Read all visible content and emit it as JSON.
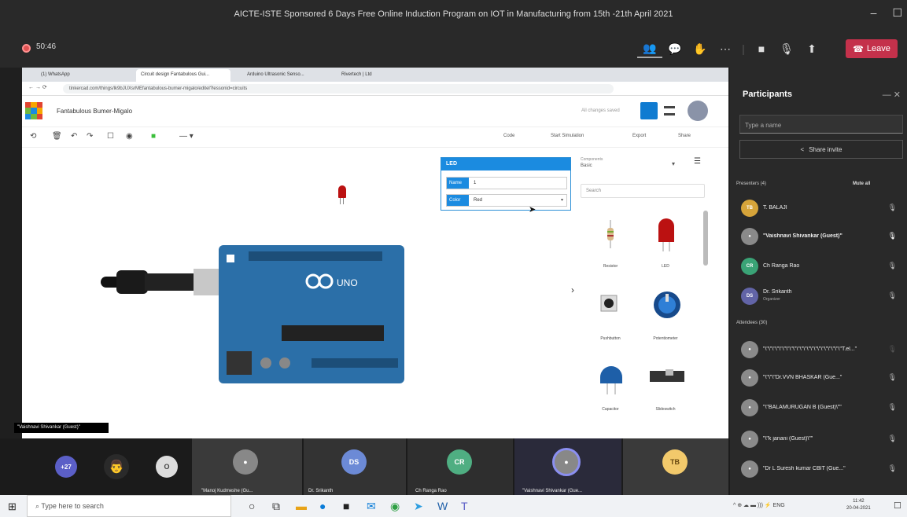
{
  "window": {
    "title": "AICTE-ISTE Sponsored 6 Days Free Online Induction Program on IOT in Manufacturing from 15th -21th April 2021",
    "minimize": "–",
    "maximize": "☐"
  },
  "meeting": {
    "timer": "50:46",
    "leave_label": "Leave"
  },
  "browser": {
    "tabs": [
      "(1) WhatsApp",
      "Circuit design Fantabulous Gui...",
      "Arduino Ultrasonic Senso...",
      "Rivertech | Ltd"
    ],
    "url": "tinkercad.com/things/lk9bJUXsrMEfantabulous-bumer-migalo/editel?lessonid=circuits"
  },
  "tinkercad": {
    "design_name": "Fantabulous Bumer-Migalo",
    "all_changes": "All changes saved",
    "code": "Code",
    "start_sim": "Start Simulation",
    "export": "Export",
    "share": "Share",
    "led_panel": {
      "title": "LED",
      "name_label": "Name",
      "name_value": "1",
      "color_label": "Color",
      "color_value": "Red"
    },
    "components": {
      "label": "Components",
      "selected": "Basic",
      "search_placeholder": "Search",
      "items": [
        "Resistor",
        "LED",
        "Pushbutton",
        "Potentiometer",
        "Capacitor",
        "Slideswitch"
      ]
    }
  },
  "arduino": {
    "brand": "UNO"
  },
  "caption": "\"Vaishnavi Shivankar (Guest)\"",
  "participants": {
    "title": "Participants",
    "search_placeholder": "Type a name",
    "share_invite": "Share invite",
    "presenters_header": "Presenters (4)",
    "mute_all": "Mute all",
    "attendees_header": "Attendees (30)",
    "presenters": [
      {
        "initials": "TB",
        "name": "T. BALAJI",
        "color": "#d6a43a"
      },
      {
        "initials": "",
        "name": "\"Vaishnavi Shivankar (Guest)\"",
        "color": "#8a8a8a"
      },
      {
        "initials": "CR",
        "name": "Ch Ranga Rao",
        "color": "#3aa376"
      },
      {
        "initials": "DS",
        "name": "Dr. Srikanth",
        "sub": "Organizer",
        "color": "#6264a7"
      }
    ],
    "attendees": [
      {
        "name": "\"\\\"\\\"\\\"\\\"\\\"\\\"\\\"\\\"\\\"\\\"\\\"\\\"\\\"\\\"\\\"\\\"\\\"\\\"\\\"\\\"\\\"\\\"T.el...\""
      },
      {
        "name": "\"\\\"\\\"\\\"Dr.VVN BHASKAR (Gue...\""
      },
      {
        "name": "\"\\\"BALAMURUGAN B (Guest)\\\"\""
      },
      {
        "name": "\"\\\"k janani (Guest)\\\"\""
      },
      {
        "name": "\"Dr L Suresh kumar CBIT (Gue...\""
      }
    ]
  },
  "video_strip": {
    "overflow": "+27",
    "o_tile": "O",
    "tiles": [
      {
        "label": "\"Manoj Kudmeshe (Gu...",
        "initials": ""
      },
      {
        "label": "Dr. Srikanth",
        "initials": "DS"
      },
      {
        "label": "Ch Ranga Rao",
        "initials": "CR"
      },
      {
        "label": "\"Vaishnavi Shivankar (Gue...",
        "initials": ""
      },
      {
        "label": "",
        "initials": "TB"
      }
    ]
  },
  "taskbar": {
    "search": "Type here to search",
    "lang": "ENG",
    "time": "11:42",
    "date": "20-04-2021"
  }
}
